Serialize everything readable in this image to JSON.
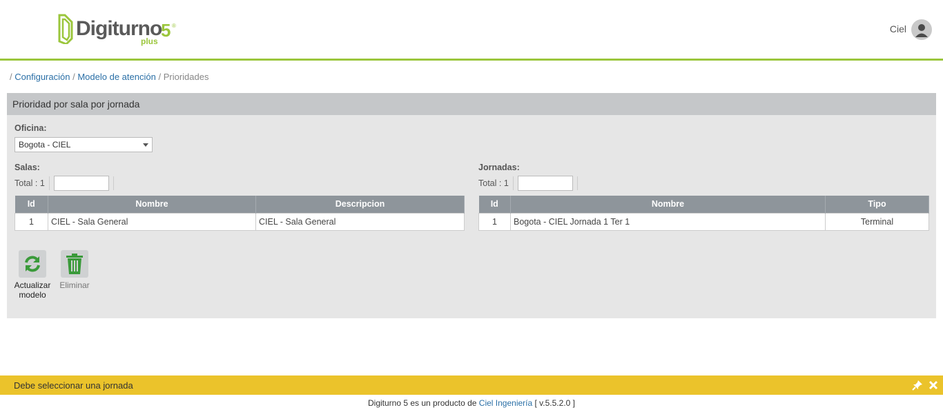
{
  "header": {
    "logo_text": "Digiturno",
    "logo_number": "5",
    "logo_reg": "®",
    "logo_sub": "plus",
    "user_name": "Ciel",
    "brand_color": "#9bc63c"
  },
  "breadcrumb": {
    "sep": "/",
    "items": [
      "Configuración",
      "Modelo de atención",
      "Prioridades"
    ]
  },
  "panel": {
    "title": "Prioridad por sala por jornada",
    "oficina_label": "Oficina:",
    "oficina_value": "Bogota - CIEL",
    "salas": {
      "label": "Salas:",
      "total_label": "Total :",
      "total_value": "1",
      "search_value": "",
      "columns": [
        "Id",
        "Nombre",
        "Descripcion"
      ],
      "rows": [
        {
          "id": "1",
          "nombre": "CIEL - Sala General",
          "descripcion": "CIEL - Sala General"
        }
      ]
    },
    "jornadas": {
      "label": "Jornadas:",
      "total_label": "Total :",
      "total_value": "1",
      "search_value": "",
      "columns": [
        "Id",
        "Nombre",
        "Tipo"
      ],
      "rows": [
        {
          "id": "1",
          "nombre": "Bogota - CIEL Jornada 1 Ter 1",
          "tipo": "Terminal"
        }
      ]
    },
    "actions": {
      "refresh_label_line1": "Actualizar",
      "refresh_label_line2": "modelo",
      "delete_label": "Eliminar"
    }
  },
  "notification": {
    "text": "Debe seleccionar una jornada",
    "color": "#ebc32b"
  },
  "footer": {
    "prefix": "Digiturno 5 es un producto de",
    "link": "Ciel Ingeniería",
    "version": "[ v.5.5.2.0 ]"
  }
}
